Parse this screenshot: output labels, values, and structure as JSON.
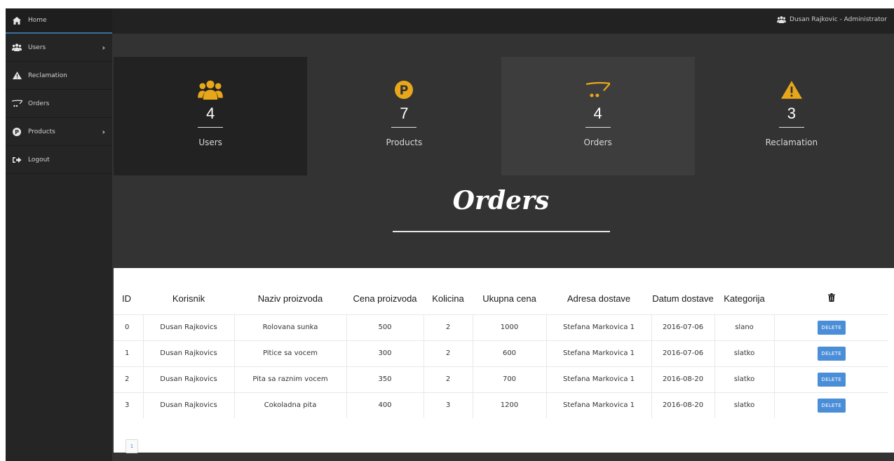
{
  "header": {
    "user": "Dusan Rajkovic - Administrator"
  },
  "sidebar": {
    "items": [
      {
        "label": "Home",
        "icon": "home-icon"
      },
      {
        "label": "Users",
        "icon": "users-icon",
        "has_submenu": true
      },
      {
        "label": "Reclamation",
        "icon": "warning-icon"
      },
      {
        "label": "Orders",
        "icon": "cart-icon"
      },
      {
        "label": "Products",
        "icon": "product-icon",
        "has_submenu": true
      },
      {
        "label": "Logout",
        "icon": "logout-icon"
      }
    ]
  },
  "stats": [
    {
      "value": "4",
      "label": "Users",
      "icon": "users-icon",
      "bg": "#222222"
    },
    {
      "value": "7",
      "label": "Products",
      "icon": "product-icon",
      "bg": "#333333"
    },
    {
      "value": "4",
      "label": "Orders",
      "icon": "cart-icon",
      "bg": "#3d3d3d"
    },
    {
      "value": "3",
      "label": "Reclamation",
      "icon": "warning-icon",
      "bg": "#333333"
    }
  ],
  "colors": {
    "accent": "#e8a71b",
    "button": "#4a8ed8"
  },
  "page": {
    "title": "Orders"
  },
  "table": {
    "headers": [
      "ID",
      "Korisnik",
      "Naziv proizvoda",
      "Cena proizvoda",
      "Kolicina",
      "Ukupna cena",
      "Adresa dostave",
      "Datum dostave",
      "Kategorija"
    ],
    "delete_header_icon": "trash-icon",
    "delete_label": "DELETE",
    "rows": [
      {
        "id": "0",
        "korisnik": "Dusan Rajkovics",
        "naziv": "Rolovana sunka",
        "cena": "500",
        "kolicina": "2",
        "ukupna": "1000",
        "adresa": "Stefana Markovica 1",
        "datum": "2016-07-06",
        "kategorija": "slano"
      },
      {
        "id": "1",
        "korisnik": "Dusan Rajkovics",
        "naziv": "Pitice sa vocem",
        "cena": "300",
        "kolicina": "2",
        "ukupna": "600",
        "adresa": "Stefana Markovica 1",
        "datum": "2016-07-06",
        "kategorija": "slatko"
      },
      {
        "id": "2",
        "korisnik": "Dusan Rajkovics",
        "naziv": "Pita sa raznim vocem",
        "cena": "350",
        "kolicina": "2",
        "ukupna": "700",
        "adresa": "Stefana Markovica 1",
        "datum": "2016-08-20",
        "kategorija": "slatko"
      },
      {
        "id": "3",
        "korisnik": "Dusan Rajkovics",
        "naziv": "Cokoladna pita",
        "cena": "400",
        "kolicina": "3",
        "ukupna": "1200",
        "adresa": "Stefana Markovica 1",
        "datum": "2016-08-20",
        "kategorija": "slatko"
      }
    ]
  },
  "pagination": {
    "current": "1"
  }
}
